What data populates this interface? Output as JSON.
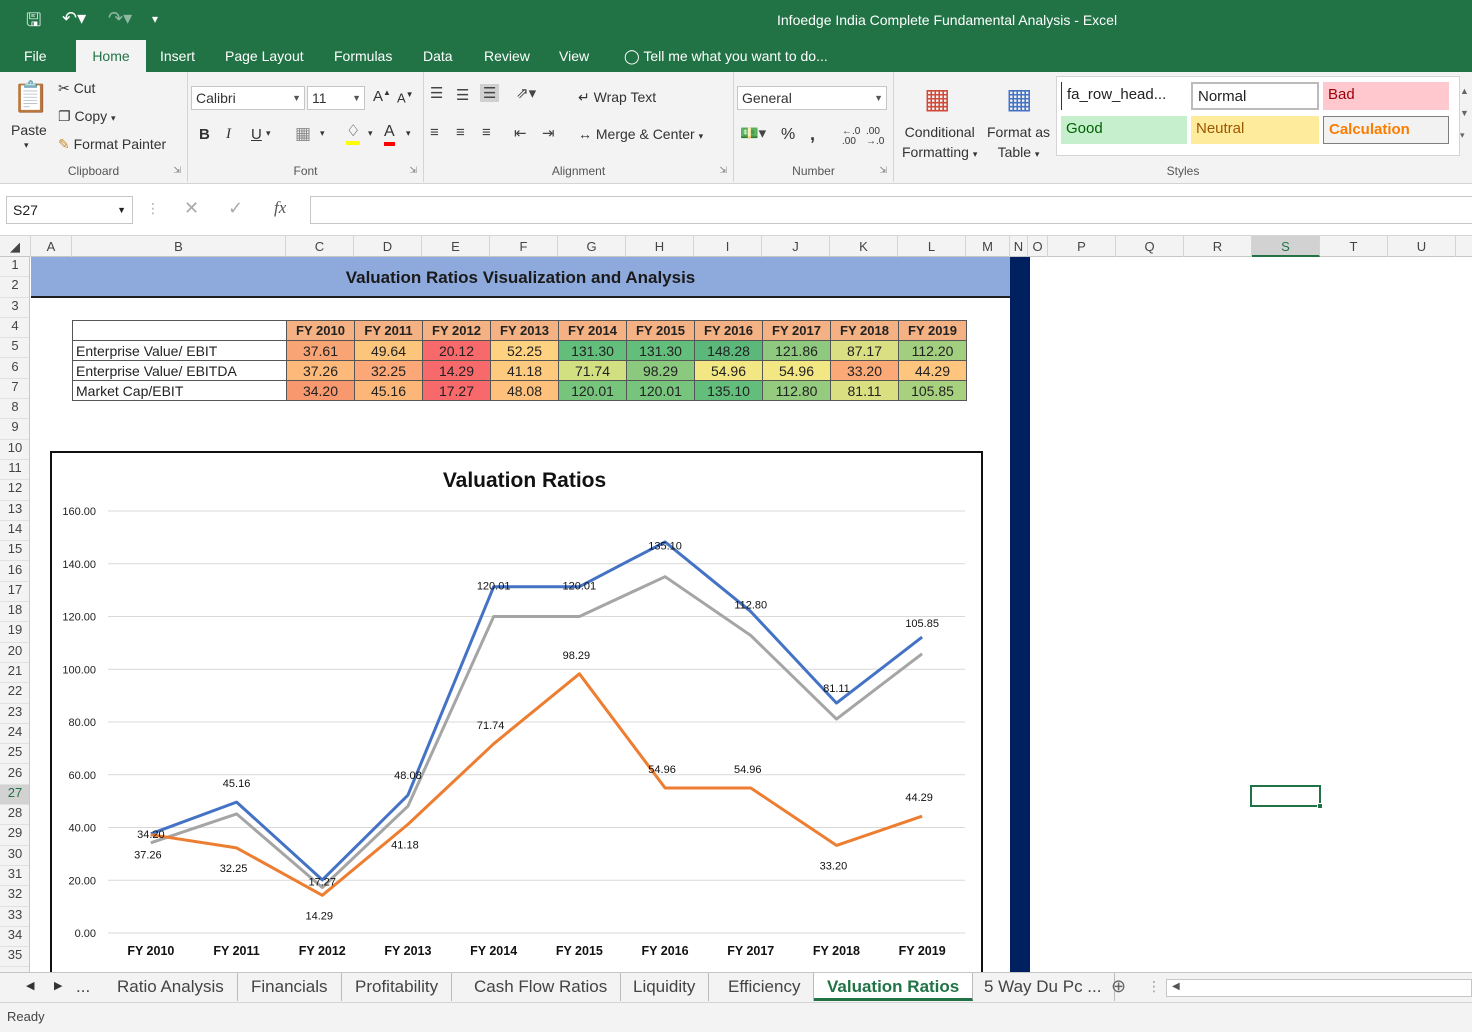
{
  "window": {
    "title": "Infoedge India Complete Fundamental Analysis - Excel"
  },
  "ribbon_tabs": [
    "File",
    "Home",
    "Insert",
    "Page Layout",
    "Formulas",
    "Data",
    "Review",
    "View"
  ],
  "tell_me": "Tell me what you want to do...",
  "clipboard": {
    "paste": "Paste",
    "cut": "Cut",
    "copy": "Copy",
    "format_painter": "Format Painter",
    "label": "Clipboard"
  },
  "font": {
    "name": "Calibri",
    "size": "11",
    "bold": "B",
    "italic": "I",
    "underline": "U",
    "grow": "A",
    "shrink": "A",
    "color": "A",
    "label": "Font"
  },
  "alignment": {
    "wrap_text": "Wrap Text",
    "merge_center": "Merge & Center",
    "label": "Alignment"
  },
  "number": {
    "format": "General",
    "percent": "%",
    "comma": ",",
    "label": "Number"
  },
  "styles": {
    "conditional_formatting": "Conditional Formatting",
    "conditional_formatting_l1": "Conditional",
    "conditional_formatting_l2": "Formatting",
    "format_as_table_l1": "Format as",
    "format_as_table_l2": "Table",
    "fa_row_head": "fa_row_head...",
    "normal": "Normal",
    "bad": "Bad",
    "good": "Good",
    "neutral": "Neutral",
    "calculation": "Calculation",
    "label": "Styles",
    "colors": {
      "good": "#c6efce",
      "neutral": "#ffeb9c",
      "bad": "#ffc7ce",
      "calculation": "#f2f2f2"
    }
  },
  "formula_bar": {
    "name_box": "S27",
    "fx": "fx",
    "formula": ""
  },
  "columns": [
    "A",
    "B",
    "C",
    "D",
    "E",
    "F",
    "G",
    "H",
    "I",
    "J",
    "K",
    "L",
    "M",
    "N",
    "O",
    "P",
    "Q",
    "R",
    "S",
    "T",
    "U"
  ],
  "rows": [
    "1",
    "2",
    "3",
    "4",
    "5",
    "6",
    "7",
    "8",
    "9",
    "10",
    "11",
    "12",
    "13",
    "14",
    "15",
    "16",
    "17",
    "18",
    "19",
    "20",
    "21",
    "22",
    "23",
    "24",
    "25",
    "26",
    "27",
    "28",
    "29",
    "30",
    "31",
    "32",
    "33",
    "34",
    "35"
  ],
  "sheet": {
    "banner_title": "Valuation Ratios Visualization and Analysis",
    "table": {
      "years": [
        "FY 2010",
        "FY 2011",
        "FY 2012",
        "FY 2013",
        "FY 2014",
        "FY 2015",
        "FY 2016",
        "FY 2017",
        "FY 2018",
        "FY 2019"
      ],
      "rows": [
        {
          "label": "Enterprise Value/ EBIT",
          "values": [
            "37.61",
            "49.64",
            "20.12",
            "52.25",
            "131.30",
            "131.30",
            "148.28",
            "121.86",
            "87.17",
            "112.20"
          ],
          "colors": [
            "#f8a475",
            "#fbc57b",
            "#f8696b",
            "#fed280",
            "#63be7b",
            "#63be7b",
            "#5cb87a",
            "#8ec97f",
            "#d9df82",
            "#a2ce7f"
          ]
        },
        {
          "label": "Enterprise Value/ EBITDA",
          "values": [
            "37.26",
            "32.25",
            "14.29",
            "41.18",
            "71.74",
            "98.29",
            "54.96",
            "54.96",
            "33.20",
            "44.29"
          ],
          "colors": [
            "#fcb97a",
            "#fba777",
            "#f8696b",
            "#fecb7e",
            "#d3e082",
            "#8ac97e",
            "#f3e784",
            "#f3e784",
            "#fbaa77",
            "#fdc57d"
          ]
        },
        {
          "label": "Market Cap/EBIT",
          "values": [
            "34.20",
            "45.16",
            "17.27",
            "48.08",
            "120.01",
            "120.01",
            "135.10",
            "112.80",
            "81.11",
            "105.85"
          ],
          "colors": [
            "#f8986f",
            "#fbb678",
            "#f8696b",
            "#fec07b",
            "#77c47d",
            "#77c47d",
            "#63be7b",
            "#94cb7e",
            "#dae082",
            "#a8d17f"
          ]
        }
      ]
    }
  },
  "chart_data": {
    "type": "line",
    "title": "Valuation Ratios",
    "categories": [
      "FY 2010",
      "FY 2011",
      "FY 2012",
      "FY 2013",
      "FY 2014",
      "FY 2015",
      "FY 2016",
      "FY 2017",
      "FY 2018",
      "FY 2019"
    ],
    "series": [
      {
        "values": [
          37.61,
          49.64,
          20.12,
          52.25,
          131.3,
          131.3,
          148.28,
          121.86,
          87.17,
          112.2
        ],
        "color": "#4472c4",
        "labels": false
      },
      {
        "values": [
          37.26,
          32.25,
          14.29,
          41.18,
          71.74,
          98.29,
          54.96,
          54.96,
          33.2,
          44.29
        ],
        "color": "#ed7d31",
        "labels": true
      },
      {
        "values": [
          34.2,
          45.16,
          17.27,
          48.08,
          120.01,
          120.01,
          135.1,
          112.8,
          81.11,
          105.85
        ],
        "color": "#a5a5a5",
        "labels": true
      }
    ],
    "y_ticks": [
      "0.00",
      "20.00",
      "40.00",
      "60.00",
      "80.00",
      "100.00",
      "120.00",
      "140.00",
      "160.00"
    ],
    "ylim": [
      0,
      160
    ],
    "grid": true,
    "legend": "none"
  },
  "sheet_tabs": [
    "...",
    "Ratio Analysis",
    "Financials",
    "Profitability",
    "Cash Flow Ratios",
    "Liquidity",
    "Efficiency",
    "Valuation Ratios",
    "5 Way Du Pc ..."
  ],
  "active_sheet": "Valuation Ratios",
  "status": "Ready"
}
